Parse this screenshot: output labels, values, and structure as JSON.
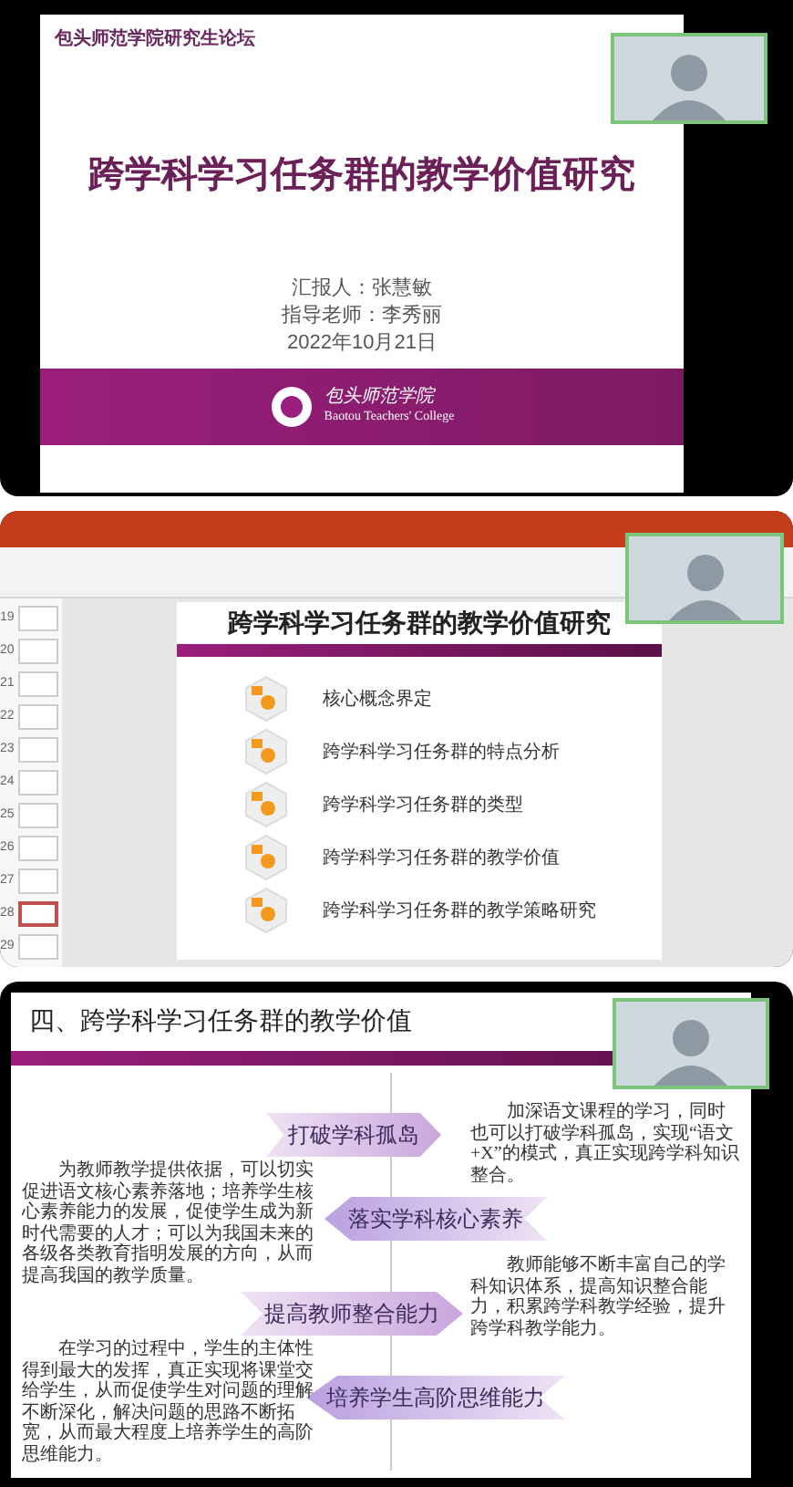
{
  "top_share": {
    "header": "包头师范学院研究生论坛",
    "title": "跨学科学习任务群的教学价值研究",
    "reporter": "汇报人：张慧敏",
    "advisor": "指导老师：李秀丽",
    "date": "2022年10月21日",
    "college_cn": "包头师范学院",
    "college_en": "Baotou Teachers' College"
  },
  "middle_share": {
    "thumbnails": [
      {
        "number": "19",
        "selected": false
      },
      {
        "number": "20",
        "selected": false
      },
      {
        "number": "21",
        "selected": false
      },
      {
        "number": "22",
        "selected": false
      },
      {
        "number": "23",
        "selected": false
      },
      {
        "number": "24",
        "selected": false
      },
      {
        "number": "25",
        "selected": false
      },
      {
        "number": "26",
        "selected": false
      },
      {
        "number": "27",
        "selected": false
      },
      {
        "number": "28",
        "selected": true
      },
      {
        "number": "29",
        "selected": false
      }
    ],
    "slide": {
      "title": "跨学科学习任务群的教学价值研究",
      "items": [
        "核心概念界定",
        "跨学科学习任务群的特点分析",
        "跨学科学习任务群的类型",
        "跨学科学习任务群的教学价值",
        "跨学科学习任务群的教学策略研究"
      ]
    }
  },
  "bottom_share": {
    "title": "四、跨学科学习任务群的教学价值",
    "branches": [
      {
        "label": "打破学科孤岛",
        "kind": "right",
        "text": "加深语文课程的学习，同时也可以打破学科孤岛，实现“语文+X”的模式，真正实现跨学科知识整合。"
      },
      {
        "label": "落实学科核心素养",
        "kind": "left",
        "text": "为教师教学提供依据，可以切实促进语文核心素养落地；培养学生核心素养能力的发展，促使学生成为新时代需要的人才；可以为我国未来的各级各类教育指明发展的方向，从而提高我国的教学质量。"
      },
      {
        "label": "提高教师整合能力",
        "kind": "right",
        "text": "教师能够不断丰富自己的学科知识体系，提高知识整合能力，积累跨学科教学经验，提升跨学科教学能力。"
      },
      {
        "label": "培养学生高阶思维能力",
        "kind": "left",
        "text": "在学习的过程中，学生的主体性得到最大的发挥，真正实现将课堂交给学生，从而促使学生对问题的理解不断深化，解决问题的思路不断拓宽，从而最大程度上培养学生的高阶思维能力。"
      }
    ]
  }
}
